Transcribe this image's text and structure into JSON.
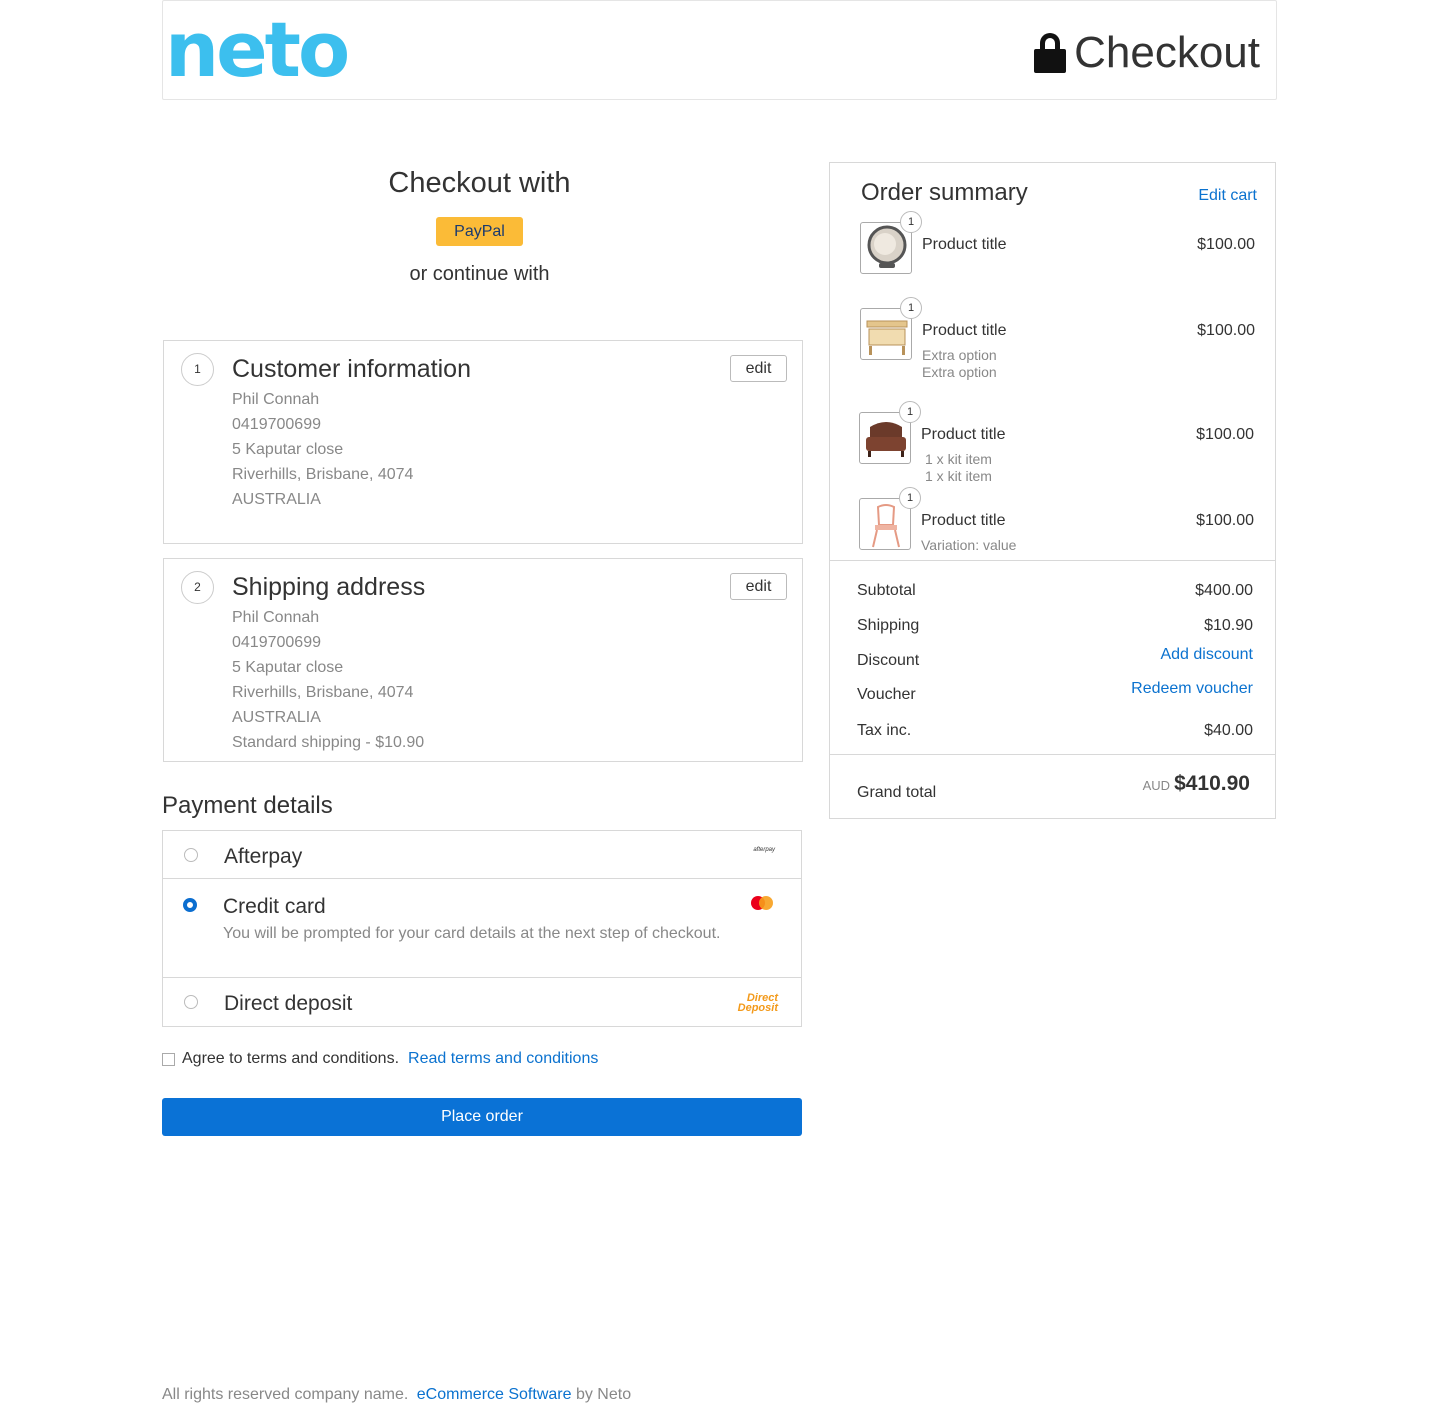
{
  "header": {
    "logo_text": "neto",
    "title": "Checkout",
    "lock_icon": "lock-icon"
  },
  "checkout_with": {
    "heading": "Checkout with",
    "paypal_label": "PayPal",
    "or_continue": "or continue with"
  },
  "customer": {
    "step": "1",
    "title": "Customer information",
    "edit_label": "edit",
    "lines": [
      "Phil Connah",
      "0419700699",
      "5 Kaputar close",
      "Riverhills, Brisbane, 4074",
      "AUSTRALIA"
    ]
  },
  "shipping": {
    "step": "2",
    "title": "Shipping address",
    "edit_label": "edit",
    "lines": [
      "Phil Connah",
      "0419700699",
      "5 Kaputar close",
      "Riverhills, Brisbane, 4074",
      "AUSTRALIA",
      "Standard shipping - $10.90"
    ]
  },
  "payment": {
    "title": "Payment details",
    "options": [
      {
        "name": "Afterpay",
        "selected": false,
        "logo_text": "afterpay"
      },
      {
        "name": "Credit card",
        "selected": true,
        "desc": "You will be prompted for your card details at the next step of checkout."
      },
      {
        "name": "Direct deposit",
        "selected": false,
        "logo_line1": "Direct",
        "logo_line2": "Deposit"
      }
    ]
  },
  "terms": {
    "label": "Agree to terms and conditions.",
    "link": "Read terms and conditions",
    "checked": false
  },
  "place_order_label": "Place order",
  "summary": {
    "title": "Order summary",
    "edit_cart": "Edit cart",
    "items": [
      {
        "qty": "1",
        "title": "Product title",
        "price": "$100.00",
        "subs": []
      },
      {
        "qty": "1",
        "title": "Product title",
        "price": "$100.00",
        "subs": [
          "Extra option",
          "Extra option"
        ]
      },
      {
        "qty": "1",
        "title": "Product title",
        "price": "$100.00",
        "subs": [
          "1 x kit item",
          "1 x kit item"
        ]
      },
      {
        "qty": "1",
        "title": "Product title",
        "price": "$100.00",
        "subs": [
          "Variation: value"
        ]
      }
    ],
    "subtotal_label": "Subtotal",
    "subtotal": "$400.00",
    "shipping_label": "Shipping",
    "shipping": "$10.90",
    "discount_label": "Discount",
    "discount_link": "Add discount",
    "voucher_label": "Voucher",
    "voucher_link": "Redeem voucher",
    "tax_label": "Tax inc.",
    "tax": "$40.00",
    "grand_label": "Grand total",
    "currency": "AUD",
    "grand_total": "$410.90"
  },
  "footer": {
    "text": "All rights reserved company name.",
    "link": "eCommerce Software",
    "suffix": "by Neto"
  },
  "colors": {
    "brand": "#3cbfee",
    "primary": "#0a72d6",
    "link": "#0b72cf",
    "paypal": "#fbbb37"
  }
}
